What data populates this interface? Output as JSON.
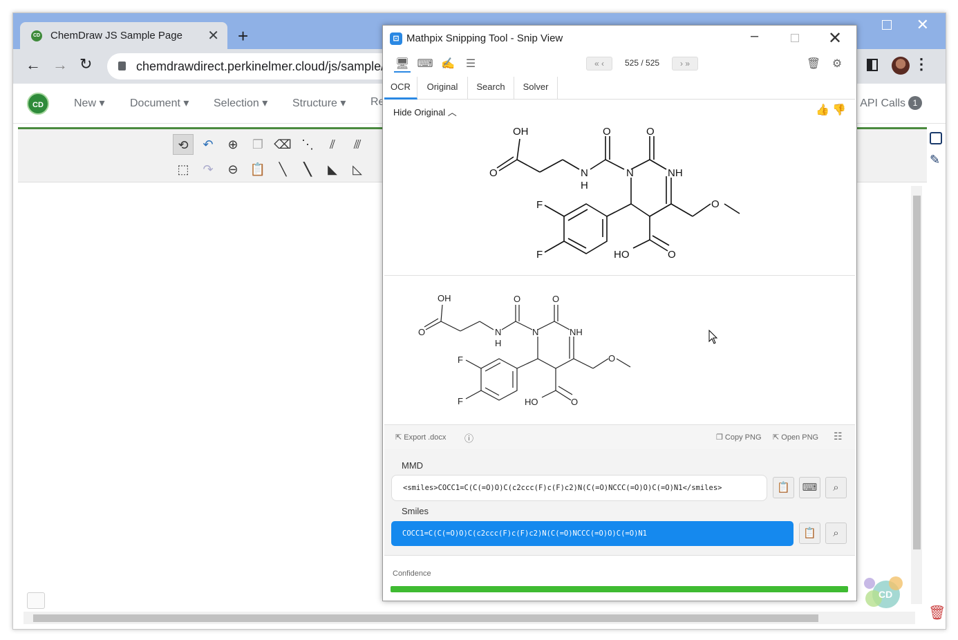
{
  "browser": {
    "tab_title": "ChemDraw JS Sample Page",
    "tab_close": "✕",
    "new_tab": "+",
    "url": "chemdrawdirect.perkinelmer.cloud/js/sample/i",
    "window_close": "✕"
  },
  "app": {
    "logo_text": "CD",
    "menu": [
      "New ▾",
      "Document ▾",
      "Selection ▾",
      "Structure ▾",
      "Re"
    ],
    "api_calls_label": "API Calls",
    "api_calls_count": "1"
  },
  "mathpix": {
    "title": "Mathpix Snipping Tool - Snip View",
    "counter": "525 / 525",
    "tabs": [
      "OCR",
      "Original",
      "Search",
      "Solver"
    ],
    "active_tab": "OCR",
    "hide_original": "Hide Original",
    "export_docx": "Export .docx",
    "copy_png": "Copy PNG",
    "open_png": "Open PNG",
    "mmd_label": "MMD",
    "mmd_value": "<smiles>COCC1=C(C(=O)O)C(c2ccc(F)c(F)c2)N(C(=O)NCCC(=O)O)C(=O)N1</smiles>",
    "smiles_label": "Smiles",
    "smiles_value": "COCC1=C(C(=O)O)C(c2ccc(F)c(F)c2)N(C(=O)NCCC(=O)O)C(=O)N1",
    "confidence_label": "Confidence",
    "confidence_value": 1.0
  },
  "molecule_labels": {
    "oh": "OH",
    "o": "O",
    "n": "N",
    "h": "H",
    "nh": "NH",
    "f": "F",
    "ho": "HO"
  },
  "colors": {
    "accent": "#2a88e3",
    "smiles_bg": "#1589ee",
    "confidence": "#3fbb32",
    "chemdraw_green": "#4a8a3e"
  }
}
